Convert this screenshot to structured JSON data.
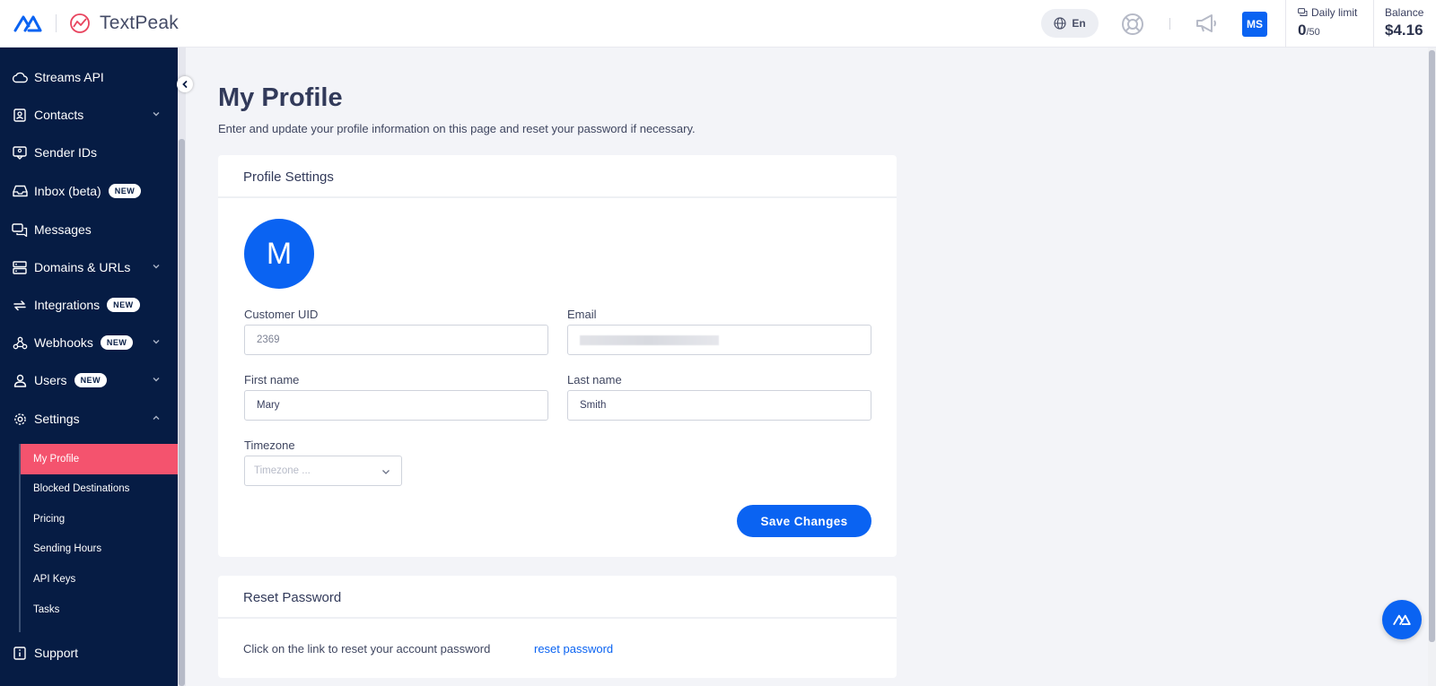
{
  "app": {
    "brand_name": "TextPeak"
  },
  "header": {
    "language": "En",
    "user_initials": "MS",
    "daily_limit_label": "Daily limit",
    "daily_limit_used": "0",
    "daily_limit_total": "/50",
    "balance_label": "Balance",
    "balance_value": "$4.16"
  },
  "sidebar": {
    "items": [
      {
        "label": "Streams API",
        "icon": "cloud-icon",
        "badge": "",
        "expandable": false
      },
      {
        "label": "Contacts",
        "icon": "contacts-icon",
        "badge": "",
        "expandable": true
      },
      {
        "label": "Sender IDs",
        "icon": "sender-id-icon",
        "badge": "",
        "expandable": false
      },
      {
        "label": "Inbox (beta)",
        "icon": "inbox-icon",
        "badge": "NEW",
        "expandable": false
      },
      {
        "label": "Messages",
        "icon": "messages-icon",
        "badge": "",
        "expandable": false
      },
      {
        "label": "Domains & URLs",
        "icon": "server-icon",
        "badge": "",
        "expandable": true
      },
      {
        "label": "Integrations",
        "icon": "sync-icon",
        "badge": "NEW",
        "expandable": false
      },
      {
        "label": "Webhooks",
        "icon": "webhook-icon",
        "badge": "NEW",
        "expandable": true
      },
      {
        "label": "Users",
        "icon": "user-icon",
        "badge": "NEW",
        "expandable": true
      },
      {
        "label": "Settings",
        "icon": "gear-icon",
        "badge": "",
        "expandable": true
      }
    ],
    "settings_sub": [
      {
        "label": "My Profile",
        "active": true
      },
      {
        "label": "Blocked Destinations",
        "active": false
      },
      {
        "label": "Pricing",
        "active": false
      },
      {
        "label": "Sending Hours",
        "active": false
      },
      {
        "label": "API Keys",
        "active": false
      },
      {
        "label": "Tasks",
        "active": false
      }
    ],
    "support": "Support"
  },
  "main": {
    "title": "My Profile",
    "description": "Enter and update your profile information on this page and reset your password if necessary.",
    "profile_card": {
      "title": "Profile Settings",
      "avatar_letter": "M",
      "customer_uid_label": "Customer UID",
      "customer_uid_value": "2369",
      "email_label": "Email",
      "first_name_label": "First name",
      "first_name_value": "Mary",
      "last_name_label": "Last name",
      "last_name_value": "Smith",
      "timezone_label": "Timezone",
      "timezone_placeholder": "Timezone ...",
      "save_label": "Save Changes"
    },
    "reset_card": {
      "title": "Reset Password",
      "text": "Click on the link to reset your account password",
      "link_label": "reset password"
    }
  },
  "colors": {
    "primary": "#0a63f2",
    "sidebar_bg": "#061c44",
    "active_item": "#f4536e",
    "page_bg": "#f3f4f8"
  }
}
